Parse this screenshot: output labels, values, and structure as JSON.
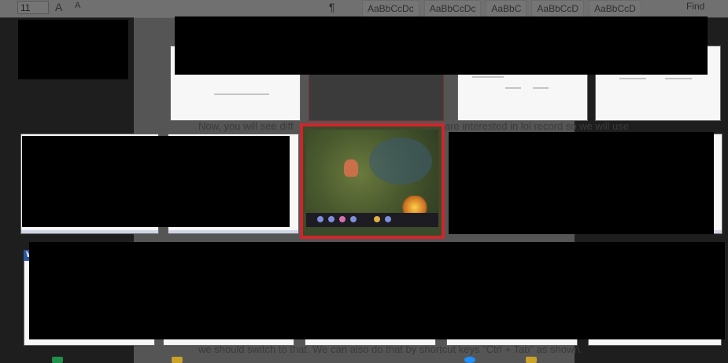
{
  "ribbon": {
    "font_size": "11",
    "grow_font": "A",
    "shrink_font": "A",
    "pilcrow": "¶",
    "find": "Find",
    "styles": [
      "AaBbCcDc",
      "AaBbCcDc",
      "AaBbC",
      "AaBbCcD",
      "AaBbCcD"
    ]
  },
  "document": {
    "line_top": "Now, you will see diff",
    "line_top_end": "are interested in lol record so we will use",
    "line_bottom": "we should switch to that. We can also do that by shortcut keys \"Ctrl + Tab\" as shown."
  },
  "switcher": {
    "prev_arrow": "‹",
    "word_badge": "W"
  },
  "colors": {
    "selection_border": "#d0252b",
    "redaction": "#000000",
    "word_blue": "#2b579a"
  }
}
